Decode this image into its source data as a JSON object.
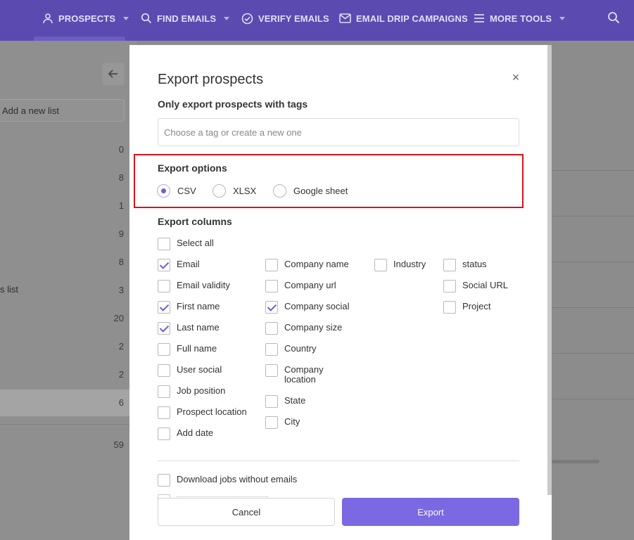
{
  "nav": {
    "items": [
      {
        "label": "PROSPECTS",
        "icon": "person-icon",
        "has_caret": true
      },
      {
        "label": "FIND EMAILS",
        "icon": "search-icon",
        "has_caret": true
      },
      {
        "label": "VERIFY EMAILS",
        "icon": "check-circle-icon",
        "has_caret": false
      },
      {
        "label": "EMAIL DRIP CAMPAIGNS",
        "icon": "envelope-icon",
        "has_caret": false
      },
      {
        "label": "MORE TOOLS",
        "icon": "menu-icon",
        "has_caret": true
      }
    ],
    "search_icon": "search-icon"
  },
  "background": {
    "add_list_placeholder": "Add a new list",
    "list_label_fragment": "s list",
    "counts": [
      "0",
      "8",
      "1",
      "9",
      "8",
      "3",
      "20",
      "2",
      "2",
      "6",
      "59"
    ]
  },
  "modal": {
    "title": "Export prospects",
    "close_icon": "close-icon",
    "tags": {
      "heading": "Only export prospects with tags",
      "placeholder": "Choose a tag or create a new one",
      "value": ""
    },
    "export_options": {
      "heading": "Export options",
      "options": [
        {
          "label": "CSV",
          "selected": true
        },
        {
          "label": "XLSX",
          "selected": false
        },
        {
          "label": "Google sheet",
          "selected": false
        }
      ]
    },
    "export_columns": {
      "heading": "Export columns",
      "select_all": {
        "label": "Select all",
        "checked": false
      },
      "columns": [
        [
          {
            "label": "Email",
            "checked": true
          },
          {
            "label": "Email validity",
            "checked": false
          },
          {
            "label": "First name",
            "checked": true
          },
          {
            "label": "Last name",
            "checked": true
          },
          {
            "label": "Full name",
            "checked": false
          },
          {
            "label": "User social",
            "checked": false
          },
          {
            "label": "Job position",
            "checked": false
          },
          {
            "label": "Prospect location",
            "checked": false
          },
          {
            "label": "Add date",
            "checked": false
          }
        ],
        [
          {
            "label": "Company name",
            "checked": false
          },
          {
            "label": "Company url",
            "checked": false
          },
          {
            "label": "Company social",
            "checked": true
          },
          {
            "label": "Company size",
            "checked": false
          },
          {
            "label": "Country",
            "checked": false
          },
          {
            "label": "Company location",
            "checked": false
          },
          {
            "label": "State",
            "checked": false
          },
          {
            "label": "City",
            "checked": false
          }
        ],
        [
          {
            "label": "Industry",
            "checked": false
          }
        ],
        [
          {
            "label": "status",
            "checked": false
          },
          {
            "label": "Social URL",
            "checked": false
          },
          {
            "label": "Project",
            "checked": false
          }
        ]
      ]
    },
    "download_jobs": {
      "label": "Download jobs without emails",
      "checked": false
    },
    "buttons": {
      "cancel": "Cancel",
      "export": "Export"
    }
  },
  "colors": {
    "nav_bg": "#5b4bb0",
    "accent": "#7b68e3",
    "check": "#6d5fd6",
    "highlight_border": "#d9121b"
  }
}
